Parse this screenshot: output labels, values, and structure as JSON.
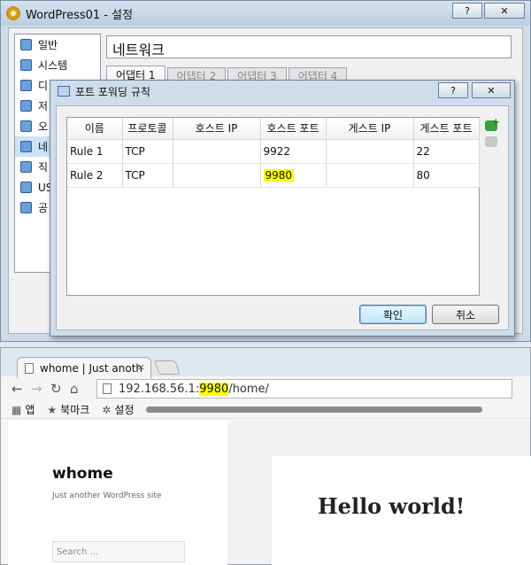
{
  "settings_window": {
    "title": "WordPress01 - 설정",
    "help_button": "?",
    "close_button": "✕",
    "categories": [
      {
        "label": "일반"
      },
      {
        "label": "시스템"
      },
      {
        "label": "디"
      },
      {
        "label": "저"
      },
      {
        "label": "오"
      },
      {
        "label": "네"
      },
      {
        "label": "직"
      },
      {
        "label": "US"
      },
      {
        "label": "공"
      }
    ],
    "selected_category": "네트워크",
    "page_title": "네트워크",
    "adapter_tabs": [
      "어댑터 1",
      "어댑터 2",
      "어댑터 3",
      "어댑터 4"
    ]
  },
  "port_forwarding_dialog": {
    "title": "포트 포워딩 규칙",
    "help_button": "?",
    "close_button": "✕",
    "columns": [
      "이름",
      "프로토콜",
      "호스트 IP",
      "호스트 포트",
      "게스트 IP",
      "게스트 포트"
    ],
    "rows": [
      {
        "name": "Rule 1",
        "protocol": "TCP",
        "host_ip": "",
        "host_port": "9922",
        "guest_ip": "",
        "guest_port": "22"
      },
      {
        "name": "Rule 2",
        "protocol": "TCP",
        "host_ip": "",
        "host_port": "9980",
        "guest_ip": "",
        "guest_port": "80"
      }
    ],
    "ok_label": "확인",
    "cancel_label": "취소",
    "highlight_color": "#ffff00"
  },
  "browser": {
    "tab_title": "whome | Just anoth",
    "tab_close": "×",
    "url": {
      "host": "192.168.56.1:",
      "port": "9980",
      "path": "/home/"
    },
    "bookmarks": [
      {
        "icon": "apps-icon",
        "label": "앱"
      },
      {
        "icon": "star-icon",
        "label": "북마크"
      },
      {
        "icon": "gear-icon",
        "label": "설정"
      }
    ],
    "site_title": "whome",
    "site_tagline": "Just another WordPress site",
    "search_placeholder": "Search ...",
    "post_title": "Hello world!"
  }
}
